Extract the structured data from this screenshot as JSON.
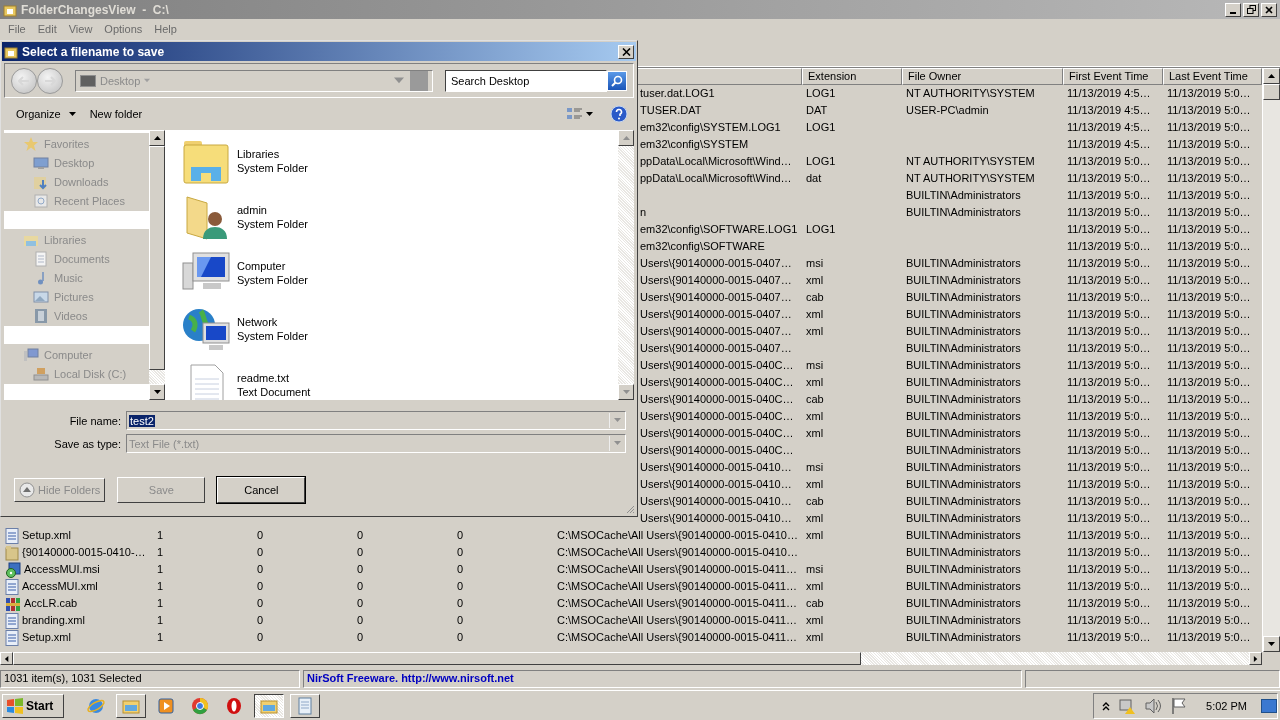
{
  "window": {
    "title": "FolderChangesView  -  C:\\"
  },
  "menu": [
    "File",
    "Edit",
    "View",
    "Options",
    "Help"
  ],
  "table": {
    "columns": [
      "Extension",
      "File Owner",
      "First Event Time",
      "Last Event Time"
    ],
    "rows": [
      {
        "column_6": "tuser.dat.LOG1",
        "extension": "LOG1",
        "file_owner": "NT AUTHORITY\\SYSTEM",
        "first_event_time": "11/13/2019 4:5…",
        "last_event_time": "11/13/2019 5:0…"
      },
      {
        "column_6": "TUSER.DAT",
        "extension": "DAT",
        "file_owner": "USER-PC\\admin",
        "first_event_time": "11/13/2019 4:5…",
        "last_event_time": "11/13/2019 5:0…"
      },
      {
        "column_6": "em32\\config\\SYSTEM.LOG1",
        "extension": "LOG1",
        "first_event_time": "11/13/2019 4:5…",
        "last_event_time": "11/13/2019 5:0…"
      },
      {
        "column_6": "em32\\config\\SYSTEM",
        "first_event_time": "11/13/2019 4:5…",
        "last_event_time": "11/13/2019 5:0…"
      },
      {
        "column_6": "ppData\\Local\\Microsoft\\Wind…",
        "extension": "LOG1",
        "file_owner": "NT AUTHORITY\\SYSTEM",
        "first_event_time": "11/13/2019 5:0…",
        "last_event_time": "11/13/2019 5:0…"
      },
      {
        "column_6": "ppData\\Local\\Microsoft\\Wind…",
        "extension": "dat",
        "file_owner": "NT AUTHORITY\\SYSTEM",
        "first_event_time": "11/13/2019 5:0…",
        "last_event_time": "11/13/2019 5:0…"
      },
      {
        "file_owner": "BUILTIN\\Administrators",
        "first_event_time": "11/13/2019 5:0…",
        "last_event_time": "11/13/2019 5:0…"
      },
      {
        "column_6": "n",
        "file_owner": "BUILTIN\\Administrators",
        "first_event_time": "11/13/2019 5:0…",
        "last_event_time": "11/13/2019 5:0…"
      },
      {
        "column_6": "em32\\config\\SOFTWARE.LOG1",
        "extension": "LOG1",
        "first_event_time": "11/13/2019 5:0…",
        "last_event_time": "11/13/2019 5:0…"
      },
      {
        "column_6": "em32\\config\\SOFTWARE",
        "first_event_time": "11/13/2019 5:0…",
        "last_event_time": "11/13/2019 5:0…"
      },
      {
        "column_6": "Users\\{90140000-0015-0407…",
        "extension": "msi",
        "file_owner": "BUILTIN\\Administrators",
        "first_event_time": "11/13/2019 5:0…",
        "last_event_time": "11/13/2019 5:0…"
      },
      {
        "column_6": "Users\\{90140000-0015-0407…",
        "extension": "xml",
        "file_owner": "BUILTIN\\Administrators",
        "first_event_time": "11/13/2019 5:0…",
        "last_event_time": "11/13/2019 5:0…"
      },
      {
        "column_6": "Users\\{90140000-0015-0407…",
        "extension": "cab",
        "file_owner": "BUILTIN\\Administrators",
        "first_event_time": "11/13/2019 5:0…",
        "last_event_time": "11/13/2019 5:0…"
      },
      {
        "column_6": "Users\\{90140000-0015-0407…",
        "extension": "xml",
        "file_owner": "BUILTIN\\Administrators",
        "first_event_time": "11/13/2019 5:0…",
        "last_event_time": "11/13/2019 5:0…"
      },
      {
        "column_6": "Users\\{90140000-0015-0407…",
        "extension": "xml",
        "file_owner": "BUILTIN\\Administrators",
        "first_event_time": "11/13/2019 5:0…",
        "last_event_time": "11/13/2019 5:0…"
      },
      {
        "column_6": "Users\\{90140000-0015-0407…",
        "file_owner": "BUILTIN\\Administrators",
        "first_event_time": "11/13/2019 5:0…",
        "last_event_time": "11/13/2019 5:0…"
      },
      {
        "column_6": "Users\\{90140000-0015-040C…",
        "extension": "msi",
        "file_owner": "BUILTIN\\Administrators",
        "first_event_time": "11/13/2019 5:0…",
        "last_event_time": "11/13/2019 5:0…"
      },
      {
        "column_6": "Users\\{90140000-0015-040C…",
        "extension": "xml",
        "file_owner": "BUILTIN\\Administrators",
        "first_event_time": "11/13/2019 5:0…",
        "last_event_time": "11/13/2019 5:0…"
      },
      {
        "column_6": "Users\\{90140000-0015-040C…",
        "extension": "cab",
        "file_owner": "BUILTIN\\Administrators",
        "first_event_time": "11/13/2019 5:0…",
        "last_event_time": "11/13/2019 5:0…"
      },
      {
        "column_6": "Users\\{90140000-0015-040C…",
        "extension": "xml",
        "file_owner": "BUILTIN\\Administrators",
        "first_event_time": "11/13/2019 5:0…",
        "last_event_time": "11/13/2019 5:0…"
      },
      {
        "column_6": "Users\\{90140000-0015-040C…",
        "extension": "xml",
        "file_owner": "BUILTIN\\Administrators",
        "first_event_time": "11/13/2019 5:0…",
        "last_event_time": "11/13/2019 5:0…"
      },
      {
        "column_6": "Users\\{90140000-0015-040C…",
        "file_owner": "BUILTIN\\Administrators",
        "first_event_time": "11/13/2019 5:0…",
        "last_event_time": "11/13/2019 5:0…"
      },
      {
        "column_6": "Users\\{90140000-0015-0410…",
        "extension": "msi",
        "file_owner": "BUILTIN\\Administrators",
        "first_event_time": "11/13/2019 5:0…",
        "last_event_time": "11/13/2019 5:0…"
      },
      {
        "column_6": "Users\\{90140000-0015-0410…",
        "extension": "xml",
        "file_owner": "BUILTIN\\Administrators",
        "first_event_time": "11/13/2019 5:0…",
        "last_event_time": "11/13/2019 5:0…"
      },
      {
        "column_6": "Users\\{90140000-0015-0410…",
        "extension": "cab",
        "file_owner": "BUILTIN\\Administrators",
        "first_event_time": "11/13/2019 5:0…",
        "last_event_time": "11/13/2019 5:0…"
      },
      {
        "column_6": "Users\\{90140000-0015-0410…",
        "extension": "xml",
        "file_owner": "BUILTIN\\Administrators",
        "first_event_time": "11/13/2019 5:0…",
        "last_event_time": "11/13/2019 5:0…"
      },
      {
        "kind": "document",
        "column_1": "Setup.xml",
        "column_2": "1",
        "column_3": "0",
        "column_4": "0",
        "column_5": "0",
        "column_6": "C:\\MSOCache\\All Users\\{90140000-0015-0410…",
        "extension": "xml",
        "file_owner": "BUILTIN\\Administrators",
        "first_event_time": "11/13/2019 5:0…",
        "last_event_time": "11/13/2019 5:0…"
      },
      {
        "kind": "folder",
        "column_1": "{90140000-0015-0410-…",
        "column_2": "1",
        "column_3": "0",
        "column_4": "0",
        "column_5": "0",
        "column_6": "C:\\MSOCache\\All Users\\{90140000-0015-0410…",
        "file_owner": "BUILTIN\\Administrators",
        "first_event_time": "11/13/2019 5:0…",
        "last_event_time": "11/13/2019 5:0…"
      },
      {
        "kind": "package",
        "column_1": "AccessMUI.msi",
        "column_2": "1",
        "column_3": "0",
        "column_4": "0",
        "column_5": "0",
        "column_6": "C:\\MSOCache\\All Users\\{90140000-0015-0411…",
        "extension": "msi",
        "file_owner": "BUILTIN\\Administrators",
        "first_event_time": "11/13/2019 5:0…",
        "last_event_time": "11/13/2019 5:0…"
      },
      {
        "kind": "document",
        "column_1": "AccessMUI.xml",
        "column_2": "1",
        "column_3": "0",
        "column_4": "0",
        "column_5": "0",
        "column_6": "C:\\MSOCache\\All Users\\{90140000-0015-0411…",
        "extension": "xml",
        "file_owner": "BUILTIN\\Administrators",
        "first_event_time": "11/13/2019 5:0…",
        "last_event_time": "11/13/2019 5:0…"
      },
      {
        "kind": "archive",
        "column_1": "AccLR.cab",
        "column_2": "1",
        "column_3": "0",
        "column_4": "0",
        "column_5": "0",
        "column_6": "C:\\MSOCache\\All Users\\{90140000-0015-0411…",
        "extension": "cab",
        "file_owner": "BUILTIN\\Administrators",
        "first_event_time": "11/13/2019 5:0…",
        "last_event_time": "11/13/2019 5:0…"
      },
      {
        "kind": "document",
        "column_1": "branding.xml",
        "column_2": "1",
        "column_3": "0",
        "column_4": "0",
        "column_5": "0",
        "column_6": "C:\\MSOCache\\All Users\\{90140000-0015-0411…",
        "extension": "xml",
        "file_owner": "BUILTIN\\Administrators",
        "first_event_time": "11/13/2019 5:0…",
        "last_event_time": "11/13/2019 5:0…"
      },
      {
        "kind": "document",
        "column_1": "Setup.xml",
        "column_2": "1",
        "column_3": "0",
        "column_4": "0",
        "column_5": "0",
        "column_6": "C:\\MSOCache\\All Users\\{90140000-0015-0411…",
        "extension": "xml",
        "file_owner": "BUILTIN\\Administrators",
        "first_event_time": "11/13/2019 5:0…",
        "last_event_time": "11/13/2019 5:0…"
      }
    ]
  },
  "status_bar": {
    "count": "1031 item(s), 1031 Selected",
    "credit": "NirSoft Freeware.  http://www.nirsoft.net"
  },
  "dialog": {
    "title": "Select a filename to save",
    "address": "Desktop",
    "search": {
      "placeholder": "Search Desktop"
    },
    "toolbar": [
      {
        "label": "Organize",
        "menu": true
      },
      {
        "label": "New folder",
        "menu": false
      }
    ],
    "nav_pane": {
      "disabled": true,
      "groups": [
        {
          "label": "Favorites",
          "kind": "star",
          "children": [
            {
              "label": "Desktop",
              "kind": "desktop"
            },
            {
              "label": "Downloads",
              "kind": "downloads"
            },
            {
              "label": "Recent Places",
              "kind": "recent"
            }
          ]
        },
        {
          "label": "Libraries",
          "kind": "library",
          "children": [
            {
              "label": "Documents",
              "kind": "documents"
            },
            {
              "label": "Music",
              "kind": "music"
            },
            {
              "label": "Pictures",
              "kind": "pictures"
            },
            {
              "label": "Videos",
              "kind": "videos"
            }
          ]
        },
        {
          "label": "Computer",
          "kind": "computer",
          "children": [
            {
              "label": "Local Disk (C:)",
              "kind": "disk"
            }
          ]
        }
      ]
    },
    "items": [
      {
        "name": "Libraries",
        "type": "System Folder",
        "kind": "library"
      },
      {
        "name": "admin",
        "type": "System Folder",
        "kind": "user"
      },
      {
        "name": "Computer",
        "type": "System Folder",
        "kind": "computer"
      },
      {
        "name": "Network",
        "type": "System Folder",
        "kind": "network"
      },
      {
        "name": "readme.txt",
        "type": "Text Document",
        "kind": "text"
      }
    ],
    "file_name": {
      "label": "File name:",
      "value": "test2",
      "selected": true
    },
    "save_as_type": {
      "label": "Save as type:",
      "value": "Text File (*.txt)",
      "disabled": true
    },
    "hide_folders": "Hide Folders",
    "buttons": [
      {
        "label": "Save",
        "disabled": true
      },
      {
        "label": "Cancel",
        "disabled": false
      }
    ]
  },
  "taskbar": {
    "start": "Start",
    "clock": "5:02 PM",
    "apps": [
      {
        "kind": "globe",
        "running": false,
        "selected": false
      },
      {
        "kind": "folders",
        "running": true,
        "selected": false
      },
      {
        "kind": "play",
        "running": false,
        "selected": false
      },
      {
        "kind": "ring",
        "running": false,
        "selected": false
      },
      {
        "kind": "stop",
        "running": false,
        "selected": false
      },
      {
        "kind": "folders",
        "running": true,
        "selected": true
      },
      {
        "kind": "notepad",
        "running": true,
        "selected": false
      }
    ]
  }
}
